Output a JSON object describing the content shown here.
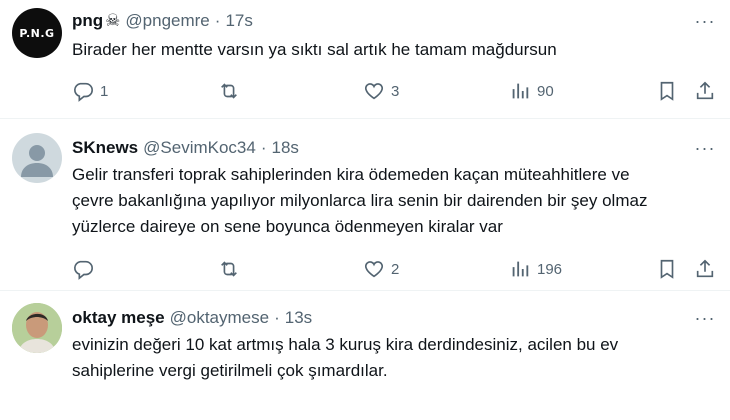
{
  "tweets": [
    {
      "name": "png",
      "handle": "@pngemre",
      "separator": "·",
      "time": "17s",
      "avatar_text": "P.N.G",
      "text": "Birader her mentte varsın ya sıktı sal artık he tamam mağdursun",
      "replies": "1",
      "retweets": "",
      "likes": "3",
      "views": "90"
    },
    {
      "name": "SKnews",
      "handle": "@SevimKoc34",
      "separator": "·",
      "time": "18s",
      "text": "Gelir transferi toprak sahiplerinden kira ödemeden kaçan müteahhitlere ve\nçevre bakanlığına yapılıyor milyonlarca lira senin bir dairenden bir şey olmaz\nyüzlerce daireye on sene boyunca ödenmeyen kiralar var",
      "replies": "",
      "retweets": "",
      "likes": "2",
      "views": "196"
    },
    {
      "name": "oktay meşe",
      "handle": "@oktaymese",
      "separator": "·",
      "time": "13s",
      "text": "evinizin değeri 10 kat artmış hala 3 kuruş kira derdindesiniz, acilen bu ev\nsahiplerine vergi getirilmeli çok şımardılar."
    }
  ],
  "icons": {
    "reply": "reply-icon",
    "retweet": "retweet-icon",
    "like": "heart-icon",
    "views": "views-icon",
    "bookmark": "bookmark-icon",
    "share": "share-icon",
    "more": "more-icon",
    "skull": "skull-crossbones-icon"
  },
  "colors": {
    "text": "#0f1419",
    "secondary": "#536471",
    "divider": "#eff3f4"
  }
}
